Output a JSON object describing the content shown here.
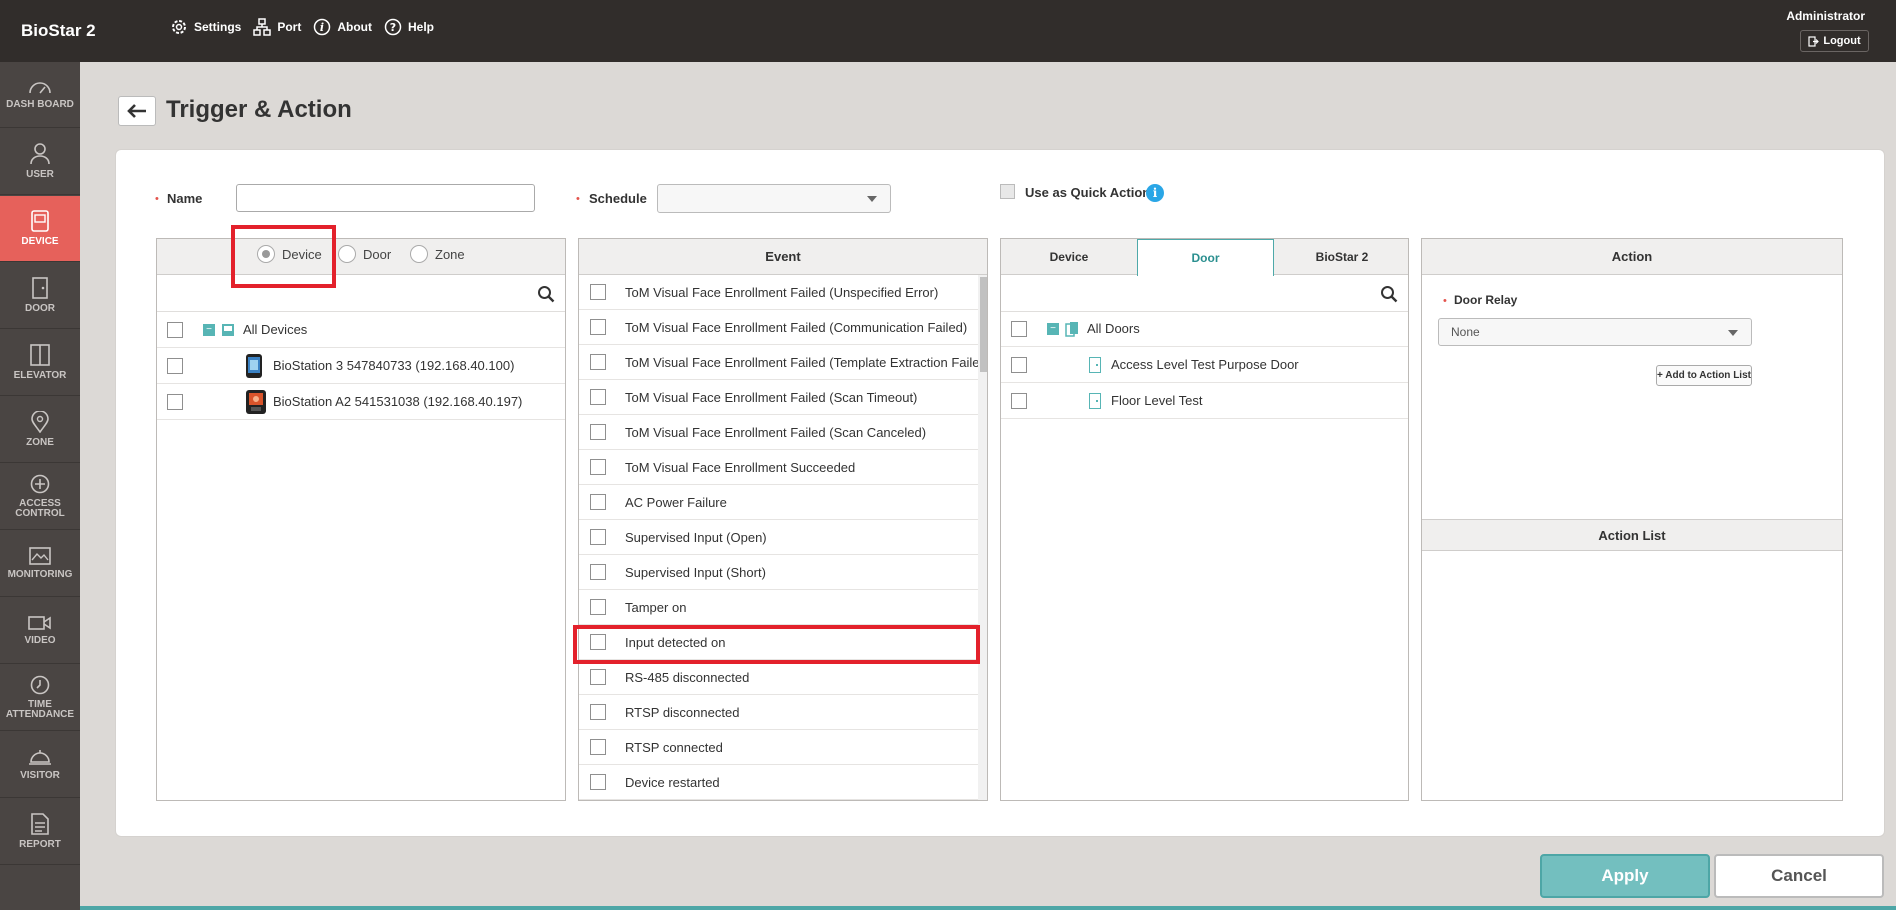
{
  "app": {
    "brand": "BioStar 2",
    "user": "Administrator",
    "logout": "Logout"
  },
  "topnav": [
    {
      "label": "Settings",
      "icon": "gear-icon"
    },
    {
      "label": "Port",
      "icon": "network-icon"
    },
    {
      "label": "About",
      "icon": "info-icon"
    },
    {
      "label": "Help",
      "icon": "help-icon"
    }
  ],
  "sidebar": [
    {
      "label": "DASH BOARD",
      "icon": "dashboard-icon"
    },
    {
      "label": "USER",
      "icon": "user-icon"
    },
    {
      "label": "DEVICE",
      "icon": "device-icon",
      "active": true
    },
    {
      "label": "DOOR",
      "icon": "door-icon"
    },
    {
      "label": "ELEVATOR",
      "icon": "elevator-icon"
    },
    {
      "label": "ZONE",
      "icon": "zone-icon"
    },
    {
      "label": "ACCESS CONTROL",
      "icon": "access-control-icon"
    },
    {
      "label": "MONITORING",
      "icon": "monitoring-icon"
    },
    {
      "label": "VIDEO",
      "icon": "video-icon"
    },
    {
      "label": "TIME ATTENDANCE",
      "icon": "clock-icon"
    },
    {
      "label": "VISITOR",
      "icon": "visitor-icon"
    },
    {
      "label": "REPORT",
      "icon": "report-icon"
    }
  ],
  "page": {
    "title": "Trigger & Action"
  },
  "form": {
    "name_label": "Name",
    "name_value": "",
    "schedule_label": "Schedule",
    "schedule_value": "",
    "quick_action_label": "Use as Quick Action",
    "info": "i"
  },
  "trigger": {
    "radios": [
      {
        "label": "Device",
        "selected": true
      },
      {
        "label": "Door",
        "selected": false
      },
      {
        "label": "Zone",
        "selected": false
      }
    ],
    "all_label": "All Devices",
    "devices": [
      "BioStation 3 547840733 (192.168.40.100)",
      "BioStation A2 541531038 (192.168.40.197)"
    ]
  },
  "event": {
    "header": "Event",
    "items": [
      "ToM Visual Face Enrollment Failed (Unspecified Error)",
      "ToM Visual Face Enrollment Failed (Communication Failed)",
      "ToM Visual Face Enrollment Failed (Template Extraction Failed)",
      "ToM Visual Face Enrollment Failed (Scan Timeout)",
      "ToM Visual Face Enrollment Failed (Scan Canceled)",
      "ToM Visual Face Enrollment Succeeded",
      "AC Power Failure",
      "Supervised Input (Open)",
      "Supervised Input (Short)",
      "Tamper on",
      "Input detected on",
      "RS-485 disconnected",
      "RTSP disconnected",
      "RTSP connected",
      "Device restarted"
    ]
  },
  "target": {
    "tabs": [
      {
        "label": "Device",
        "active": false
      },
      {
        "label": "Door",
        "active": true
      },
      {
        "label": "BioStar 2",
        "active": false
      }
    ],
    "all_label": "All Doors",
    "doors": [
      "Access Level Test Purpose Door",
      "Floor Level Test"
    ]
  },
  "action": {
    "header": "Action",
    "relay_label": "Door Relay",
    "relay_value": "None",
    "add_button": "+ Add to Action List",
    "list_header": "Action List"
  },
  "buttons": {
    "apply": "Apply",
    "cancel": "Cancel"
  },
  "colors": {
    "accent": "#4da6a6",
    "active_nav": "#e6615b",
    "highlight": "#e3212b"
  }
}
